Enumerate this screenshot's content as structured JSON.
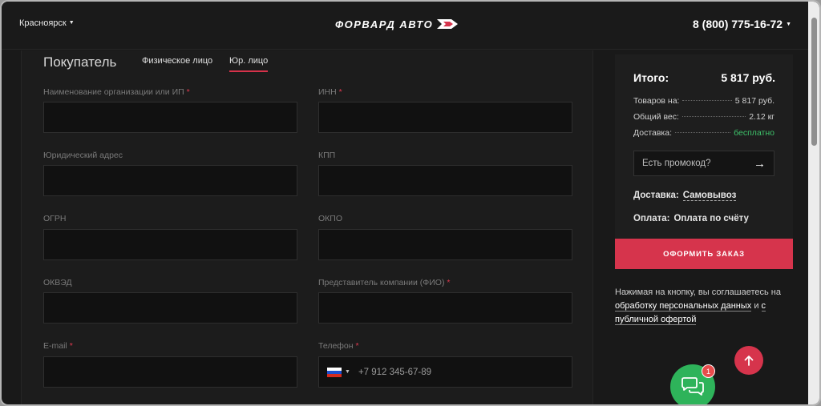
{
  "header": {
    "city": "Красноярск",
    "logo_text": "ФОРВАРД АВТО",
    "phone": "8 (800) 775-16-72"
  },
  "buyer": {
    "title": "Покупатель",
    "tabs": [
      {
        "label": "Физическое лицо",
        "active": false
      },
      {
        "label": "Юр. лицо",
        "active": true
      }
    ],
    "fields": {
      "org_name": {
        "label": "Наименование организации или ИП",
        "required": true
      },
      "inn": {
        "label": "ИНН",
        "required": true
      },
      "legal_address": {
        "label": "Юридический адрес",
        "required": false
      },
      "kpp": {
        "label": "КПП",
        "required": false
      },
      "ogrn": {
        "label": "ОГРН",
        "required": false
      },
      "okpo": {
        "label": "ОКПО",
        "required": false
      },
      "okved": {
        "label": "ОКВЭД",
        "required": false
      },
      "representative": {
        "label": "Представитель компании (ФИО)",
        "required": true
      },
      "email": {
        "label": "E-mail",
        "required": true
      },
      "phone": {
        "label": "Телефон",
        "required": true,
        "placeholder": "+7 912 345-67-89"
      }
    },
    "required_mark": "*"
  },
  "summary": {
    "total_label": "Итого:",
    "total_value": "5 817 руб.",
    "items_label": "Товаров на:",
    "items_value": "5 817 руб.",
    "weight_label": "Общий вес:",
    "weight_value": "2.12 кг",
    "delivery_label": "Доставка:",
    "delivery_value": "бесплатно",
    "promo_placeholder": "Есть промокод?",
    "delivery_method_label": "Доставка:",
    "delivery_method_value": "Самовывоз",
    "payment_label": "Оплата:",
    "payment_value": "Оплата по счёту",
    "order_button": "ОФОРМИТЬ ЗАКАЗ",
    "agree_text": "Нажимая на кнопку, вы соглашаетесь на",
    "agree_link1": "обработку персональных данных",
    "agree_and": "и",
    "agree_link2": "с публичной офертой"
  },
  "chat": {
    "badge_count": "1"
  },
  "colors": {
    "accent": "#d6344c",
    "success": "#3ec26a",
    "chat": "#2eb35a"
  },
  "icons": [
    "caret-down-icon",
    "arrow-right-icon",
    "arrow-up-icon",
    "chat-icon",
    "russia-flag-icon"
  ]
}
